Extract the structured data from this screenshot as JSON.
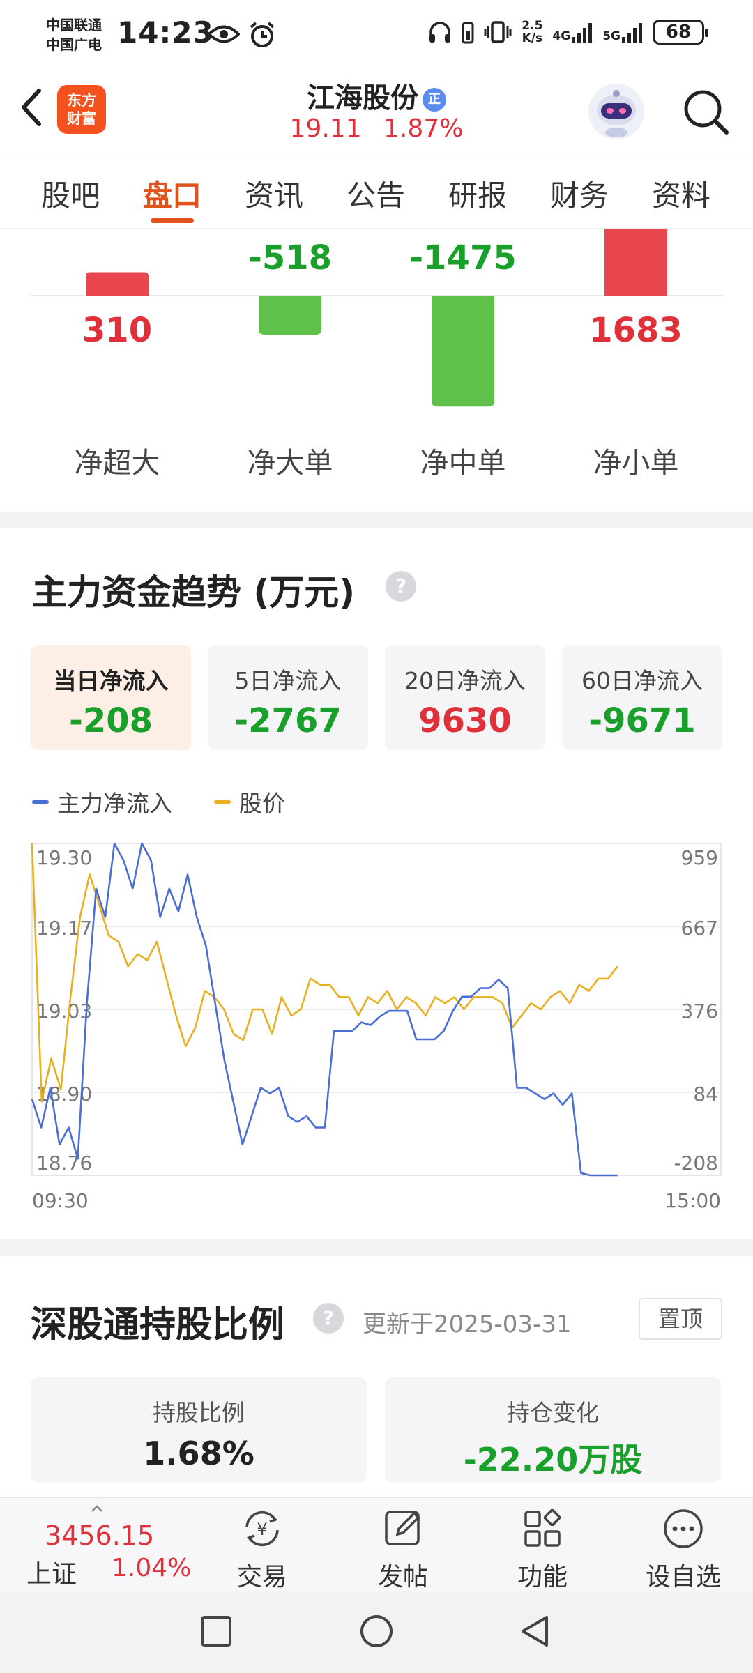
{
  "status": {
    "carrier_line1": "中国联通",
    "carrier_line2": "中国广电",
    "time": "14:23",
    "speed_value": "2.5",
    "speed_unit": "K/s",
    "net_4g": "4G",
    "net_5g": "5G",
    "battery": "68"
  },
  "header": {
    "logo_line1": "东方",
    "logo_line2": "财富",
    "stock_name": "江海股份",
    "badge": "正",
    "price": "19.11",
    "change_pct": "1.87%"
  },
  "tabs": [
    {
      "label": "股吧"
    },
    {
      "label": "盘口"
    },
    {
      "label": "资讯"
    },
    {
      "label": "公告"
    },
    {
      "label": "研报"
    },
    {
      "label": "财务"
    },
    {
      "label": "资料"
    }
  ],
  "active_tab": "盘口",
  "flow_bars": [
    {
      "label": "净超大",
      "value": "310"
    },
    {
      "label": "净大单",
      "value": "-518"
    },
    {
      "label": "净中单",
      "value": "-1475"
    },
    {
      "label": "净小单",
      "value": "1683"
    }
  ],
  "trend": {
    "title": "主力资金趋势 (万元)",
    "cards": [
      {
        "label": "当日净流入",
        "value": "-208"
      },
      {
        "label": "5日净流入",
        "value": "-2767"
      },
      {
        "label": "20日净流入",
        "value": "9630"
      },
      {
        "label": "60日净流入",
        "value": "-9671"
      }
    ],
    "legend_flow": "主力净流入",
    "legend_price": "股价"
  },
  "chart_data": {
    "type": "line",
    "x_start": "09:30",
    "x_end": "15:00",
    "left_axis_ticks": [
      "19.30",
      "19.17",
      "19.03",
      "18.90",
      "18.76"
    ],
    "right_axis_ticks": [
      "959",
      "667",
      "376",
      "84",
      "-208"
    ],
    "left_ylim": [
      18.76,
      19.3
    ],
    "right_ylim": [
      -208,
      959
    ],
    "series": [
      {
        "name": "主力净流入",
        "color": "#4a6fd4",
        "axis": "right",
        "values": [
          60,
          -40,
          100,
          -100,
          -40,
          -150,
          400,
          800,
          700,
          1000,
          900,
          800,
          1000,
          900,
          700,
          800,
          720,
          850,
          700,
          600,
          400,
          200,
          50,
          -100,
          0,
          100,
          80,
          100,
          0,
          -20,
          0,
          -40,
          -40,
          300,
          300,
          300,
          330,
          320,
          350,
          370,
          370,
          370,
          270,
          270,
          270,
          300,
          370,
          420,
          420,
          450,
          450,
          480,
          450,
          100,
          100,
          80,
          60,
          80,
          40,
          80,
          -200,
          -400,
          -300,
          -300,
          -430
        ]
      },
      {
        "name": "股价",
        "color": "#e8b020",
        "axis": "left",
        "values": [
          19.3,
          18.88,
          18.95,
          18.9,
          19.05,
          19.18,
          19.25,
          19.2,
          19.15,
          19.14,
          19.1,
          19.12,
          19.11,
          19.14,
          19.08,
          19.02,
          18.97,
          19.0,
          19.06,
          19.05,
          19.03,
          18.99,
          18.98,
          19.03,
          19.03,
          18.99,
          19.05,
          19.02,
          19.03,
          19.08,
          19.07,
          19.07,
          19.05,
          19.05,
          19.02,
          19.05,
          19.04,
          19.06,
          19.03,
          19.05,
          19.04,
          19.02,
          19.05,
          19.04,
          19.05,
          19.03,
          19.05,
          19.05,
          19.05,
          19.04,
          19.0,
          19.02,
          19.04,
          19.03,
          19.05,
          19.06,
          19.04,
          19.07,
          19.06,
          19.08,
          19.08,
          19.1
        ]
      }
    ]
  },
  "hk_connect": {
    "title": "深股通持股比例",
    "updated": "更新于2025-03-31",
    "pin_label": "置顶",
    "ratio_label": "持股比例",
    "ratio_value": "1.68%",
    "change_label": "持仓变化",
    "change_value": "-22.20万股"
  },
  "bottom_bar": {
    "index_value": "3456.15",
    "index_name": "上证",
    "index_pct": "1.04%",
    "items": [
      {
        "label": "交易",
        "icon": "trade-icon"
      },
      {
        "label": "发帖",
        "icon": "post-icon"
      },
      {
        "label": "功能",
        "icon": "function-icon"
      },
      {
        "label": "设自选",
        "icon": "more-icon"
      }
    ]
  }
}
